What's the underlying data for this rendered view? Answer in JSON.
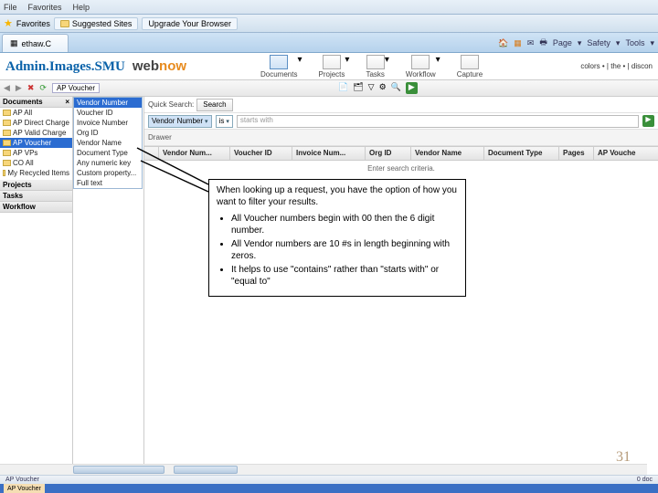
{
  "ie": {
    "menu": [
      "File",
      "Favorites",
      "Help"
    ],
    "fav_label": "Favorites",
    "suggested": "Suggested Sites",
    "upgrade": "Upgrade Your Browser",
    "tab": "ethaw.C",
    "cmds": [
      "Page",
      "Safety",
      "Tools"
    ]
  },
  "app": {
    "logo1": "Admin.Images.SMU",
    "logo2a": "web",
    "logo2b": "now",
    "tabs": [
      {
        "label": "Documents",
        "sel": true
      },
      {
        "label": "Projects"
      },
      {
        "label": "Tasks"
      },
      {
        "label": "Workflow"
      },
      {
        "label": "Capture"
      }
    ],
    "right": "colors • | the • | discon"
  },
  "toolbar_chip": "AP Voucher",
  "search": {
    "label": "Quick Search:",
    "btn": "Search"
  },
  "filter": {
    "field": "Vendor Number",
    "op": "is",
    "val_ph": "starts with"
  },
  "drawer_label": "Drawer",
  "columns": [
    "",
    "Vendor Num...",
    "Voucher ID",
    "Invoice Num...",
    "Org ID",
    "Vendor Name",
    "Document Type",
    "Pages",
    "AP Vouche"
  ],
  "hint": "Enter search criteria.",
  "left": {
    "hdr": "Documents",
    "items": [
      {
        "label": "AP All"
      },
      {
        "label": "AP Direct Charge"
      },
      {
        "label": "AP Valid Charge"
      },
      {
        "label": "AP Voucher",
        "sel": true
      },
      {
        "label": "AP VPs"
      },
      {
        "label": "CO All"
      },
      {
        "label": "My Recycled Items"
      }
    ],
    "projects": "Projects",
    "tasks": "Tasks",
    "workflow": "Workflow"
  },
  "dropdown": [
    "Vendor Number",
    "Voucher ID",
    "Invoice Number",
    "Org ID",
    "Vendor Name",
    "Document Type",
    "Any numeric key",
    "Custom property...",
    "Full text"
  ],
  "dropdown_sel": 0,
  "callout": {
    "intro": "When looking up a request, you have the option of how you want to filter your results.",
    "b1": "All Voucher numbers begin with 00 then the 6 digit number.",
    "b2": "All Vendor numbers are 10 #s in length beginning with zeros.",
    "b3": "It helps to use \"contains\" rather than \"starts with\" or \"equal to\""
  },
  "page": "31",
  "statusL": "AP Voucher",
  "statusR": "0 doc",
  "slide_tag": "AP Voucher"
}
